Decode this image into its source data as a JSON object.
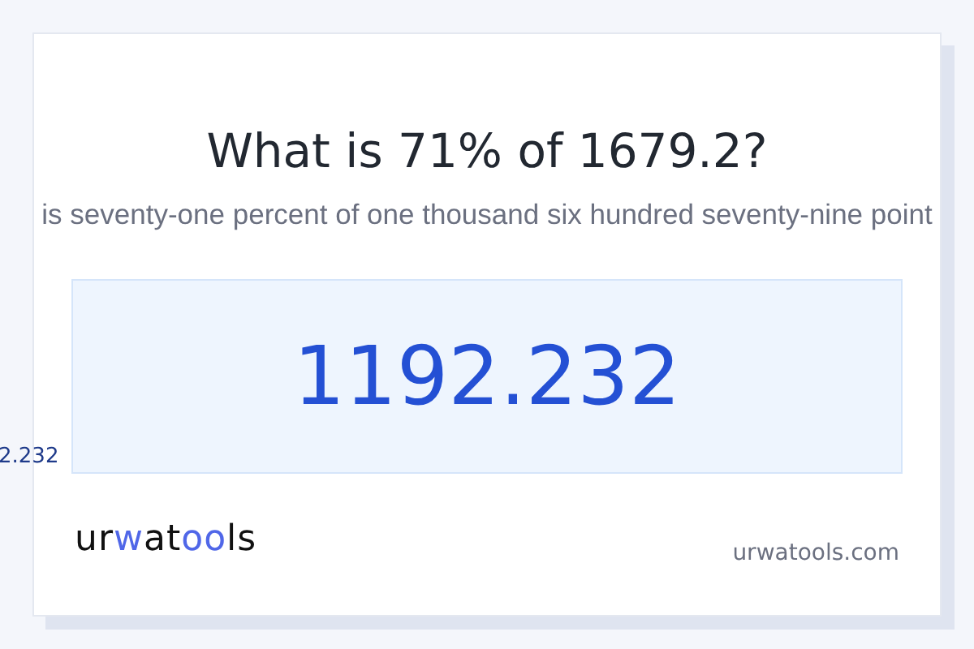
{
  "title": "What is 71% of 1679.2?",
  "sentence": "is seventy-one percent of one thousand six hundred seventy-nine point",
  "result": "1192.232",
  "side_result": "2.232",
  "logo": [
    {
      "text": "ur",
      "accent": false
    },
    {
      "text": "w",
      "accent": true
    },
    {
      "text": "at",
      "accent": false
    },
    {
      "text": "oo",
      "accent": true
    },
    {
      "text": "ls",
      "accent": false
    }
  ],
  "site": "urwatools.com"
}
